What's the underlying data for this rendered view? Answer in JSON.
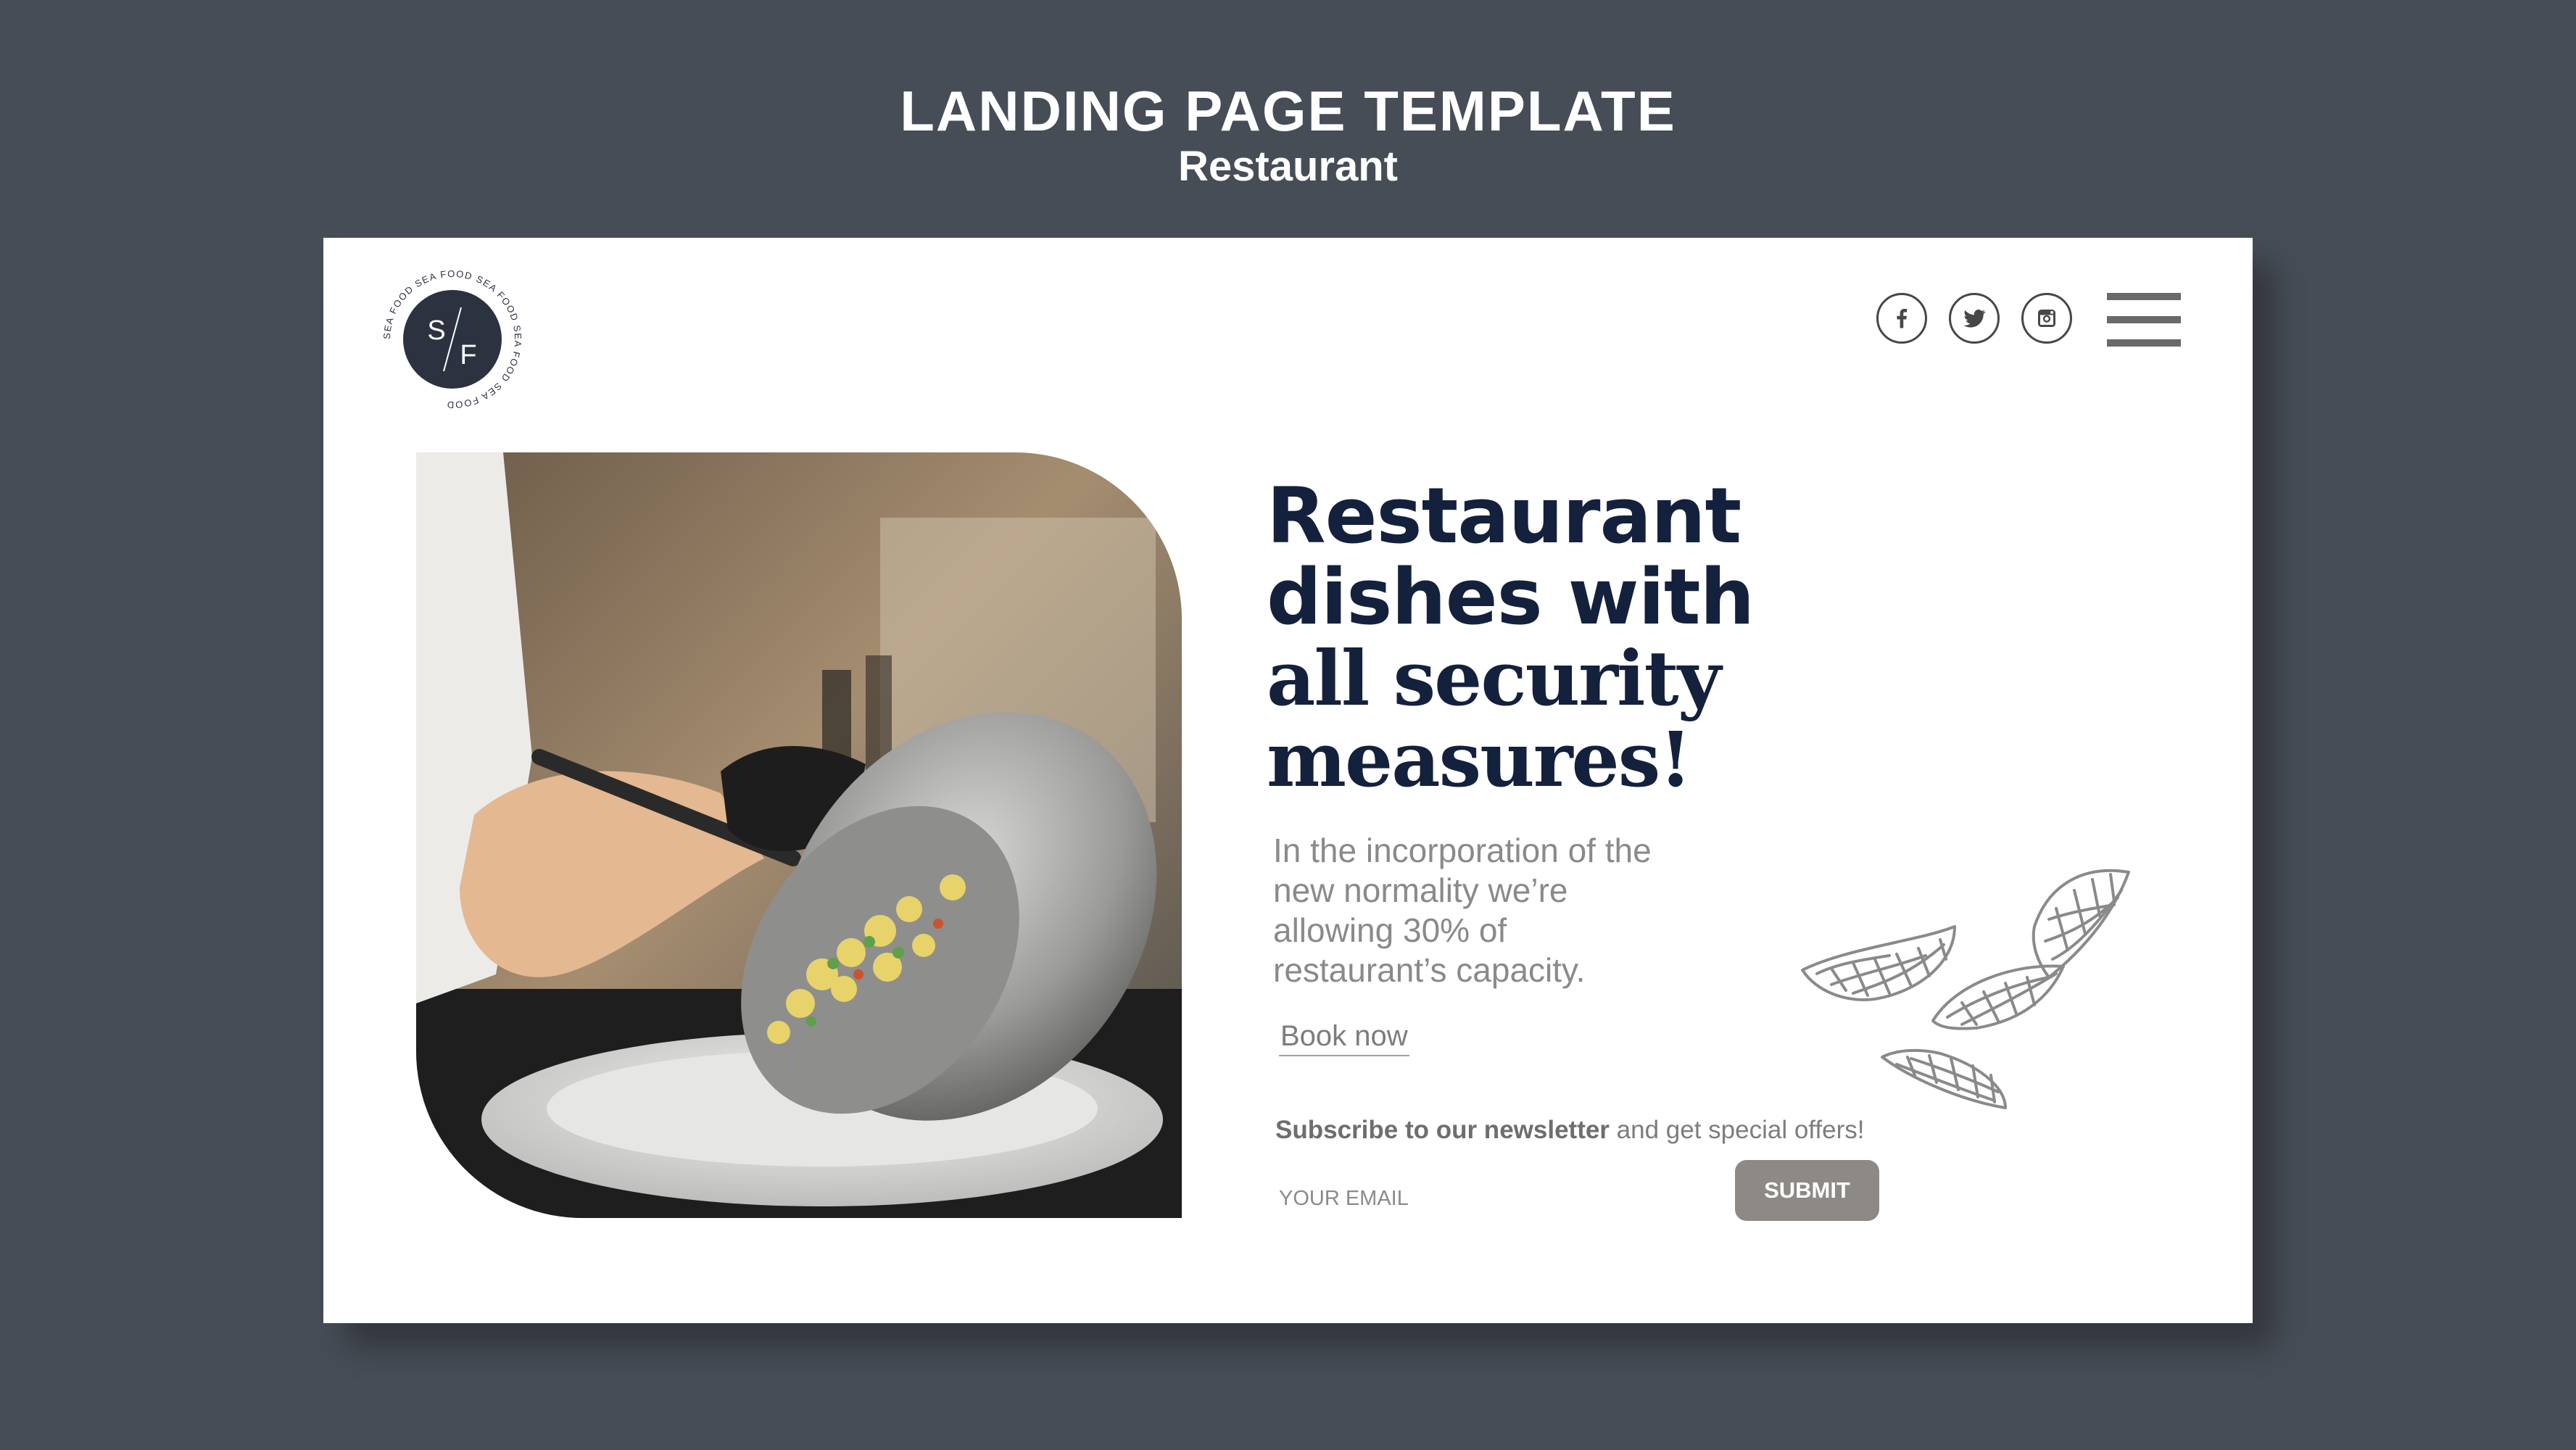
{
  "header": {
    "title": "LANDING PAGE TEMPLATE",
    "subtitle": "Restaurant"
  },
  "logo": {
    "initial_top": "S",
    "initial_bottom": "F",
    "ring_text": "SEA FOOD SEA FOOD SEA FOOD SEA FOOD SEA FOOD"
  },
  "nav": {
    "socials": [
      {
        "name": "facebook",
        "icon": "facebook-icon"
      },
      {
        "name": "twitter",
        "icon": "twitter-icon"
      },
      {
        "name": "instagram",
        "icon": "instagram-icon"
      }
    ],
    "menu_icon": "hamburger-menu-icon"
  },
  "hero": {
    "headline_line1": "Restaurant",
    "headline_line2": "dishes with",
    "headline_line3": "all security",
    "headline_line4": "measures!",
    "description": "In the incorporation of the new normality we’re allowing 30% of restaurant’s capacity.",
    "book_link": "Book now"
  },
  "newsletter": {
    "bold_text": "Subscribe to our newsletter",
    "text": " and get special offers!",
    "email_placeholder": "YOUR EMAIL",
    "submit_label": "SUBMIT"
  },
  "colors": {
    "background": "#474d57",
    "card": "#ffffff",
    "headline": "#14213d",
    "button": "#8d8a86",
    "text_muted": "#8a8a8a"
  }
}
